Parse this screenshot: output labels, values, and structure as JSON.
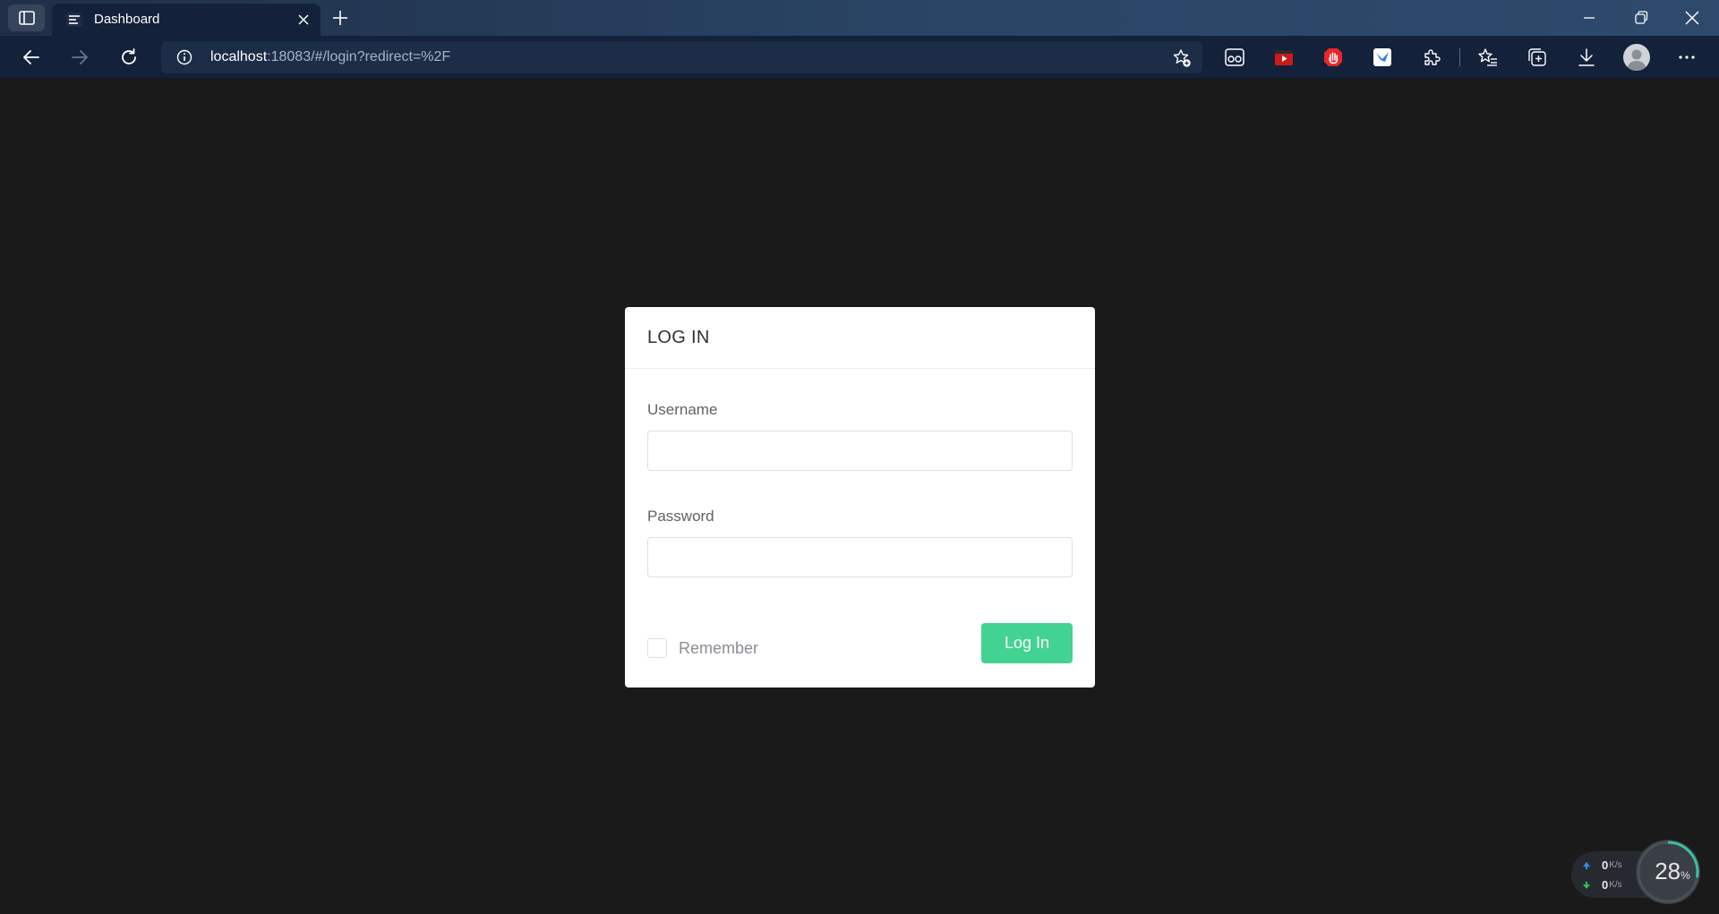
{
  "browser": {
    "tab_title": "Dashboard",
    "url_host": "localhost",
    "url_rest": ":18083/#/login?redirect=%2F",
    "icons": {
      "sidebar": "sidebar-toggle-icon",
      "tab_favicon": "dashboard-menu-icon",
      "tab_close": "close-icon",
      "new_tab": "plus-icon",
      "back": "arrow-left-icon",
      "forward": "arrow-right-icon",
      "refresh": "refresh-icon",
      "info": "info-icon",
      "add_favorite": "star-plus-icon",
      "extensions": [
        "reader-glasses-icon",
        "youtube-icon",
        "adblock-hand-icon",
        "bird-extension-icon",
        "puzzle-icon"
      ],
      "favorites": "favorites-star-icon",
      "collections": "collections-icon",
      "downloads": "download-icon",
      "profile": "profile-avatar-icon",
      "menu": "more-dots-icon"
    }
  },
  "login": {
    "title": "LOG IN",
    "username_label": "Username",
    "username_value": "",
    "password_label": "Password",
    "password_value": "",
    "remember_label": "Remember",
    "remember_checked": false,
    "submit_label": "Log In",
    "accent_color": "#42d392"
  },
  "net_monitor": {
    "upload_value": "0",
    "upload_unit": "K/s",
    "download_value": "0",
    "download_unit": "K/s",
    "cpu_value": "28",
    "cpu_unit": "%",
    "cpu_fraction": 0.28
  }
}
